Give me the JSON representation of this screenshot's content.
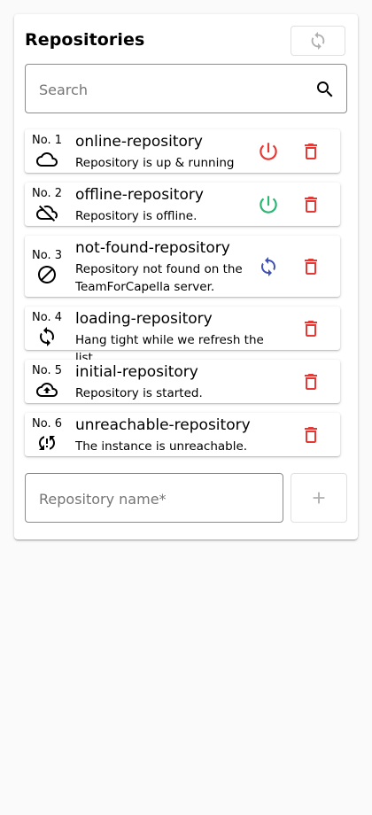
{
  "header": {
    "title": "Repositories",
    "refresh_icon": "sync-icon"
  },
  "search": {
    "placeholder": "Search",
    "icon": "search-icon"
  },
  "colors": {
    "danger": "#e53935",
    "success": "#2bb673",
    "primary": "#3f51b5",
    "disabled": "#b0b0b0"
  },
  "repositories": [
    {
      "number": "No. 1",
      "name": "online-repository",
      "status_text": "Repository is up & running",
      "status_icon": "cloud-icon",
      "action_icon": "power-icon",
      "delete_icon": "delete-icon"
    },
    {
      "number": "No. 2",
      "name": "offline-repository",
      "status_text": "Repository is offline.",
      "status_icon": "cloud-off-icon",
      "action_icon": "power-icon",
      "delete_icon": "delete-icon"
    },
    {
      "number": "No. 3",
      "name": "not-found-repository",
      "status_text": "Repository not found on the TeamForCapella server.",
      "status_icon": "block-icon",
      "action_icon": "sync-icon",
      "delete_icon": "delete-icon"
    },
    {
      "number": "No. 4",
      "name": "loading-repository",
      "status_text": "Hang tight while we refresh the list.",
      "status_icon": "sync-icon",
      "delete_icon": "delete-icon"
    },
    {
      "number": "No. 5",
      "name": "initial-repository",
      "status_text": "Repository is started.",
      "status_icon": "cloud-upload-icon",
      "delete_icon": "delete-icon"
    },
    {
      "number": "No. 6",
      "name": "unreachable-repository",
      "status_text": "The instance is unreachable.",
      "status_icon": "sync-problem-icon",
      "delete_icon": "delete-icon"
    }
  ],
  "new_repository": {
    "placeholder": "Repository name*",
    "add_icon": "add-icon"
  }
}
